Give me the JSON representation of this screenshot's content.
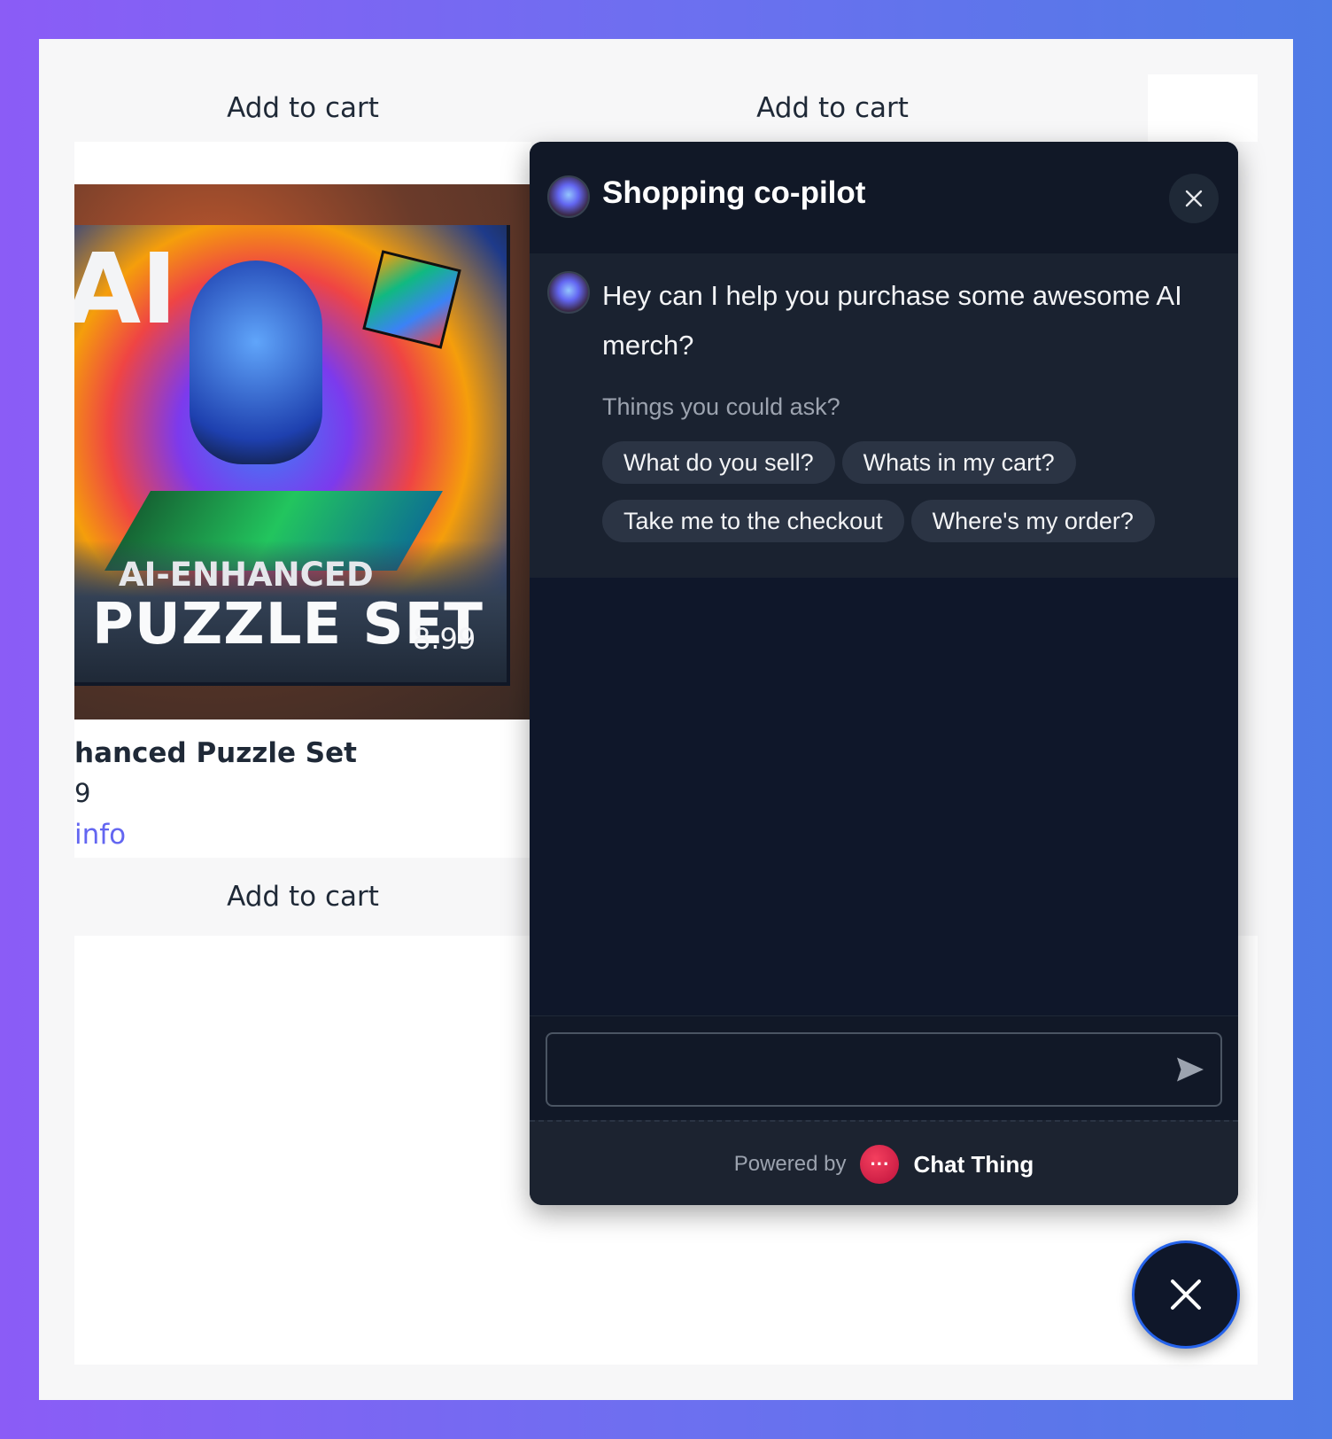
{
  "shop": {
    "add_to_cart_top_left": "Add to cart",
    "add_to_cart_top_right": "Add to cart",
    "product": {
      "image_alt": "AI-Enhanced Puzzle Set box",
      "box_line1": "AI-ENHANCED",
      "box_line2": "PUZZLE SET",
      "box_price": "8.99",
      "box_big": "AI",
      "title": "hanced Puzzle Set",
      "price": "9",
      "info_link": "info",
      "add_to_cart": "Add to cart"
    }
  },
  "chat": {
    "title": "Shopping co-pilot",
    "message": "Hey can I help you purchase some awesome AI merch?",
    "suggest_label": "Things you could ask?",
    "suggestions": [
      "What do you sell?",
      "Whats in my cart?",
      "Take me to the checkout",
      "Where's my order?"
    ],
    "input_placeholder": "",
    "footer": {
      "powered_by": "Powered by",
      "brand": "Chat Thing"
    }
  },
  "colors": {
    "accent": "#6366f1",
    "chat_bg": "#0f172a",
    "fab_border": "#2563eb",
    "brand": "#e11d48"
  },
  "icons": {
    "close": "close-icon",
    "send": "send-icon",
    "fab": "close-icon",
    "avatar": "bot-avatar-icon"
  }
}
